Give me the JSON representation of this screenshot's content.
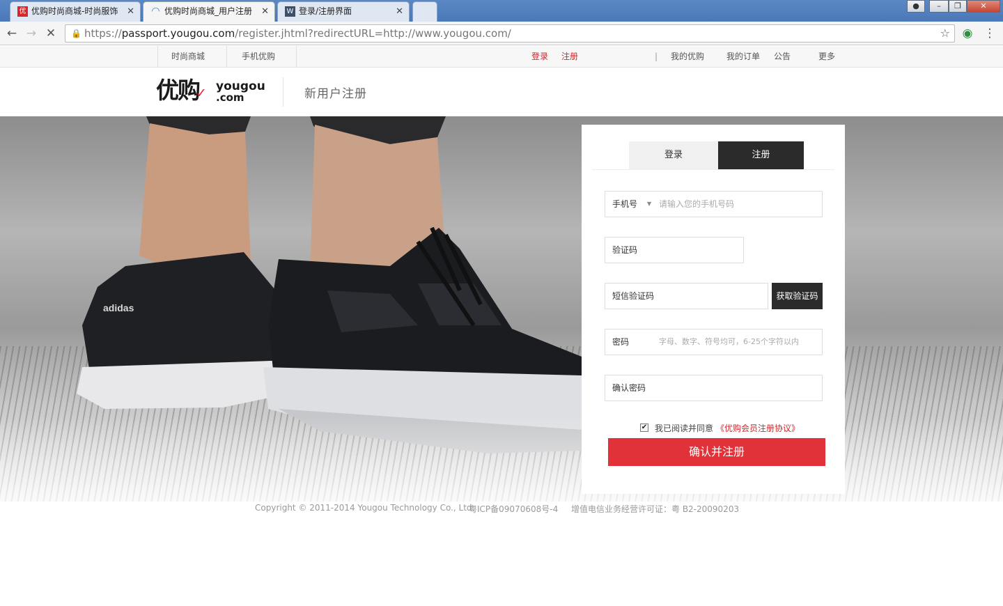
{
  "browser": {
    "tabs": [
      {
        "title": "优购时尚商城-时尚服饰"
      },
      {
        "title": "优购时尚商城_用户注册"
      },
      {
        "title": "登录/注册界面"
      }
    ],
    "url_scheme": "https://",
    "url_host": "passport.yougou.com",
    "url_path": "/register.jhtml?redirectURL=http://www.yougou.com/"
  },
  "sitenav": {
    "left": [
      "时尚商城",
      "手机优购"
    ],
    "login": "登录",
    "register": "注册",
    "right": [
      "我的优购",
      "我的订单",
      "公告",
      "更多"
    ]
  },
  "header": {
    "logo_cn": "优购",
    "logo_en": "yougou",
    "logo_dom": ".com",
    "page_title": "新用户注册"
  },
  "form": {
    "tab_login": "登录",
    "tab_register": "注册",
    "phone_prefix": "手机号",
    "phone_placeholder": "请输入您的手机号码",
    "captcha_label": "验证码",
    "sms_label": "短信验证码",
    "sms_button": "获取验证码",
    "password_label": "密码",
    "password_placeholder": "字母、数字、符号均可，6-25个字符以内",
    "confirm_label": "确认密码",
    "agree_text": "我已阅读并同意",
    "agree_link": "《优购会员注册协议》",
    "agree_checked": true,
    "submit": "确认并注册"
  },
  "hero_brand": "adidas",
  "footer": {
    "copyright": "Copyright © 2011-2014 Yougou Technology Co., Ltd.",
    "icp": "粤ICP备09070608号-4",
    "license": "增值电信业务经营许可证：粤 B2-20090203"
  },
  "colors": {
    "accent": "#e03238",
    "dark": "#2b2b2b"
  }
}
